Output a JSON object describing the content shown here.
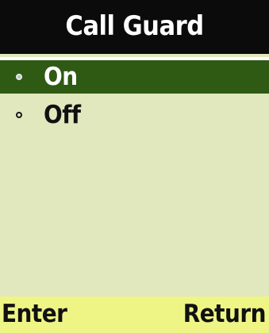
{
  "header": {
    "title": "Call Guard"
  },
  "options": [
    {
      "label": "On",
      "selected": true
    },
    {
      "label": "Off",
      "selected": false
    }
  ],
  "softkeys": {
    "left": "Enter",
    "right": "Return"
  },
  "colors": {
    "title_bar": "#0b0b0b",
    "selected_row": "#2f5a14",
    "content_bg": "#e1e8bd",
    "softkey_bar": "#eef585"
  }
}
